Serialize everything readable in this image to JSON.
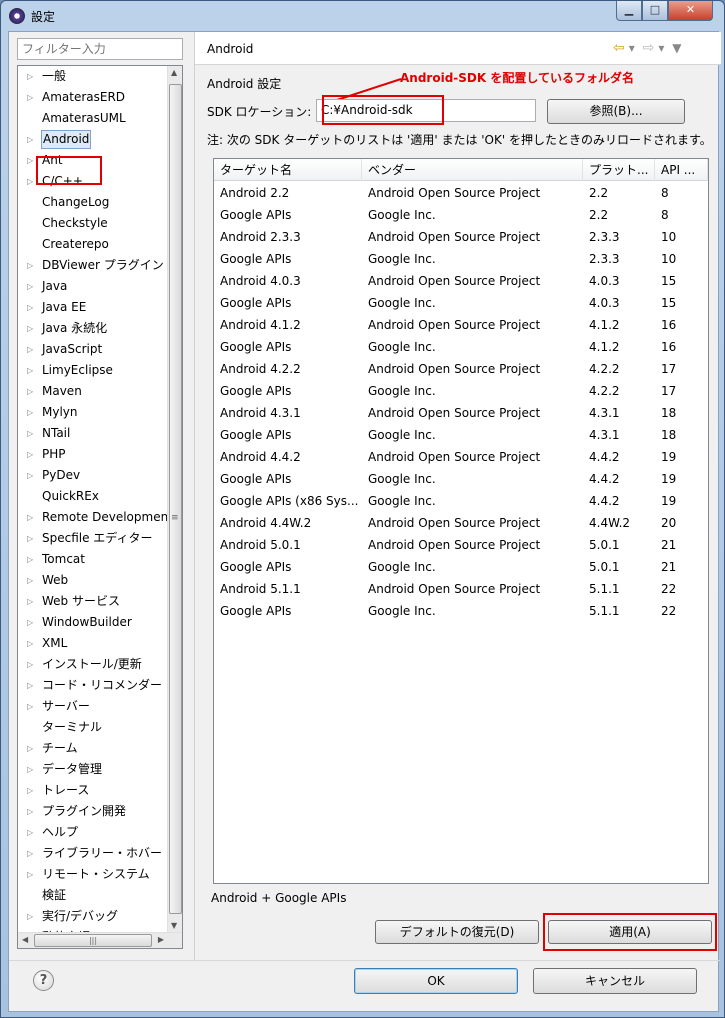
{
  "window": {
    "title": "設定"
  },
  "filter": {
    "placeholder": "フィルター入力"
  },
  "tree": {
    "items": [
      {
        "label": "一般",
        "arrow": true
      },
      {
        "label": "AmaterasERD",
        "arrow": true
      },
      {
        "label": "AmaterasUML",
        "arrow": false
      },
      {
        "label": "Android",
        "arrow": true,
        "selected": true
      },
      {
        "label": "Ant",
        "arrow": true
      },
      {
        "label": "C/C++",
        "arrow": true
      },
      {
        "label": "ChangeLog",
        "arrow": false
      },
      {
        "label": "Checkstyle",
        "arrow": false
      },
      {
        "label": "Createrepo",
        "arrow": false
      },
      {
        "label": "DBViewer プラグイン",
        "arrow": true
      },
      {
        "label": "Java",
        "arrow": true
      },
      {
        "label": "Java EE",
        "arrow": true
      },
      {
        "label": "Java 永続化",
        "arrow": true
      },
      {
        "label": "JavaScript",
        "arrow": true
      },
      {
        "label": "LimyEclipse",
        "arrow": true
      },
      {
        "label": "Maven",
        "arrow": true
      },
      {
        "label": "Mylyn",
        "arrow": true
      },
      {
        "label": "NTail",
        "arrow": true
      },
      {
        "label": "PHP",
        "arrow": true
      },
      {
        "label": "PyDev",
        "arrow": true
      },
      {
        "label": "QuickREx",
        "arrow": false
      },
      {
        "label": "Remote Development",
        "arrow": true
      },
      {
        "label": "Specfile エディター",
        "arrow": true
      },
      {
        "label": "Tomcat",
        "arrow": true
      },
      {
        "label": "Web",
        "arrow": true
      },
      {
        "label": "Web サービス",
        "arrow": true
      },
      {
        "label": "WindowBuilder",
        "arrow": true
      },
      {
        "label": "XML",
        "arrow": true
      },
      {
        "label": "インストール/更新",
        "arrow": true
      },
      {
        "label": "コード・リコメンダー",
        "arrow": true
      },
      {
        "label": "サーバー",
        "arrow": true
      },
      {
        "label": "ターミナル",
        "arrow": false
      },
      {
        "label": "チーム",
        "arrow": true
      },
      {
        "label": "データ管理",
        "arrow": true
      },
      {
        "label": "トレース",
        "arrow": true
      },
      {
        "label": "プラグイン開発",
        "arrow": true
      },
      {
        "label": "ヘルプ",
        "arrow": true
      },
      {
        "label": "ライブラリー・ホバー",
        "arrow": true
      },
      {
        "label": "リモート・システム",
        "arrow": true
      },
      {
        "label": "検証",
        "arrow": false
      },
      {
        "label": "実行/デバッグ",
        "arrow": true
      },
      {
        "label": "動的言語",
        "arrow": true
      }
    ]
  },
  "page": {
    "title": "Android",
    "section_label": "Android 設定",
    "sdk_label": "SDK ロケーション:",
    "sdk_value": "C:¥Android-sdk",
    "browse_label": "参照(B)...",
    "callout": "Android-SDK を配置しているフォルダ名",
    "note": "注: 次の SDK ターゲットのリストは '適用' または 'OK' を押したときのみリロードされます。",
    "targets_desc": "Android + Google APIs",
    "restore_label": "デフォルトの復元(D)",
    "apply_label": "適用(A)"
  },
  "table": {
    "headers": [
      "ターゲット名",
      "ベンダー",
      "プラット...",
      "API ..."
    ],
    "rows": [
      [
        "Android 2.2",
        "Android Open Source Project",
        "2.2",
        "8"
      ],
      [
        "Google APIs",
        "Google Inc.",
        "2.2",
        "8"
      ],
      [
        "Android 2.3.3",
        "Android Open Source Project",
        "2.3.3",
        "10"
      ],
      [
        "Google APIs",
        "Google Inc.",
        "2.3.3",
        "10"
      ],
      [
        "Android 4.0.3",
        "Android Open Source Project",
        "4.0.3",
        "15"
      ],
      [
        "Google APIs",
        "Google Inc.",
        "4.0.3",
        "15"
      ],
      [
        "Android 4.1.2",
        "Android Open Source Project",
        "4.1.2",
        "16"
      ],
      [
        "Google APIs",
        "Google Inc.",
        "4.1.2",
        "16"
      ],
      [
        "Android 4.2.2",
        "Android Open Source Project",
        "4.2.2",
        "17"
      ],
      [
        "Google APIs",
        "Google Inc.",
        "4.2.2",
        "17"
      ],
      [
        "Android 4.3.1",
        "Android Open Source Project",
        "4.3.1",
        "18"
      ],
      [
        "Google APIs",
        "Google Inc.",
        "4.3.1",
        "18"
      ],
      [
        "Android 4.4.2",
        "Android Open Source Project",
        "4.4.2",
        "19"
      ],
      [
        "Google APIs",
        "Google Inc.",
        "4.4.2",
        "19"
      ],
      [
        "Google APIs (x86 Sys...",
        "Google Inc.",
        "4.4.2",
        "19"
      ],
      [
        "Android 4.4W.2",
        "Android Open Source Project",
        "4.4W.2",
        "20"
      ],
      [
        "Android 5.0.1",
        "Android Open Source Project",
        "5.0.1",
        "21"
      ],
      [
        "Google APIs",
        "Google Inc.",
        "5.0.1",
        "21"
      ],
      [
        "Android 5.1.1",
        "Android Open Source Project",
        "5.1.1",
        "22"
      ],
      [
        "Google APIs",
        "Google Inc.",
        "5.1.1",
        "22"
      ]
    ]
  },
  "footer": {
    "help": "?",
    "ok_label": "OK",
    "cancel_label": "キャンセル"
  },
  "colors": {
    "highlight_red": "#e00000",
    "selection_bg": "#dde9f7"
  }
}
